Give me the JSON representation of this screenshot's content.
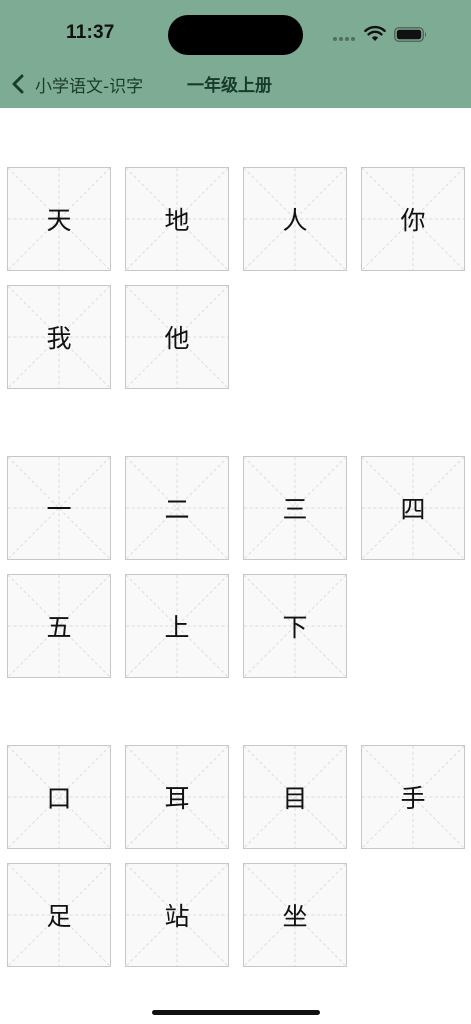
{
  "status_bar": {
    "time": "11:37"
  },
  "nav": {
    "back_label": "小学语文-识字",
    "title": "一年级上册"
  },
  "groups": [
    {
      "characters": [
        "天",
        "地",
        "人",
        "你",
        "我",
        "他"
      ]
    },
    {
      "characters": [
        "一",
        "二",
        "三",
        "四",
        "五",
        "上",
        "下"
      ]
    },
    {
      "characters": [
        "口",
        "耳",
        "目",
        "手",
        "足",
        "站",
        "坐"
      ]
    }
  ],
  "colors": {
    "header_background": "#7eab93",
    "cell_background": "#f9f9f9",
    "cell_border": "#c7c7c7",
    "guide_lines": "#d8d8d8"
  },
  "icons": {
    "back": "chevron-left-icon",
    "wifi": "wifi-icon",
    "battery": "battery-icon"
  }
}
